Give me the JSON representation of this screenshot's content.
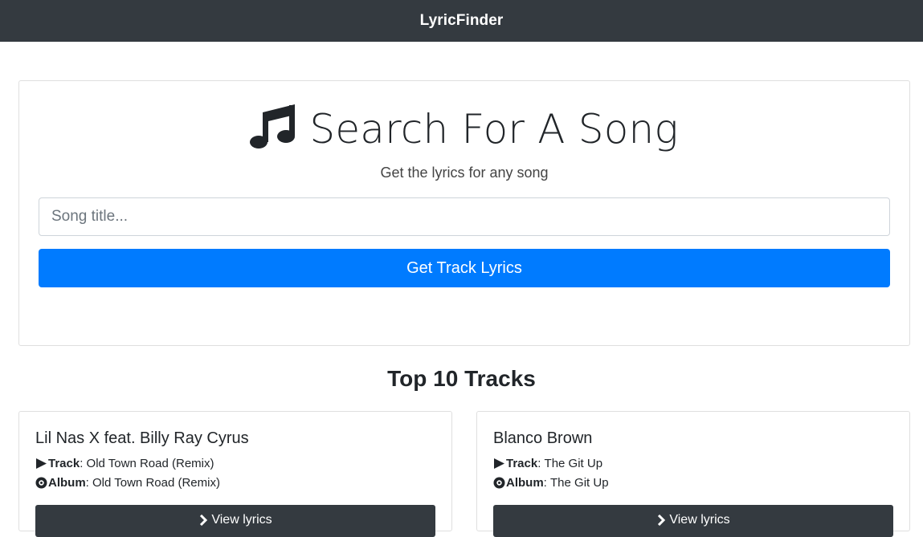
{
  "navbar": {
    "brand": "LyricFinder"
  },
  "search": {
    "title": "Search For A Song",
    "subtitle": "Get the lyrics for any song",
    "placeholder": "Song title...",
    "value": "",
    "submit_label": "Get Track Lyrics",
    "icon": "music-icon"
  },
  "top_tracks": {
    "heading": "Top 10 Tracks",
    "items": [
      {
        "artist": "Lil Nas X feat. Billy Ray Cyrus",
        "track_label": "Track",
        "track": "Old Town Road (Remix)",
        "album_label": "Album",
        "album": "Old Town Road (Remix)",
        "button_label": "View lyrics"
      },
      {
        "artist": "Blanco Brown",
        "track_label": "Track",
        "track": "The Git Up",
        "album_label": "Album",
        "album": "The Git Up",
        "button_label": "View lyrics"
      }
    ]
  },
  "colors": {
    "navbar": "#343a40",
    "primary": "#007bff",
    "dark_button": "#343a40"
  }
}
